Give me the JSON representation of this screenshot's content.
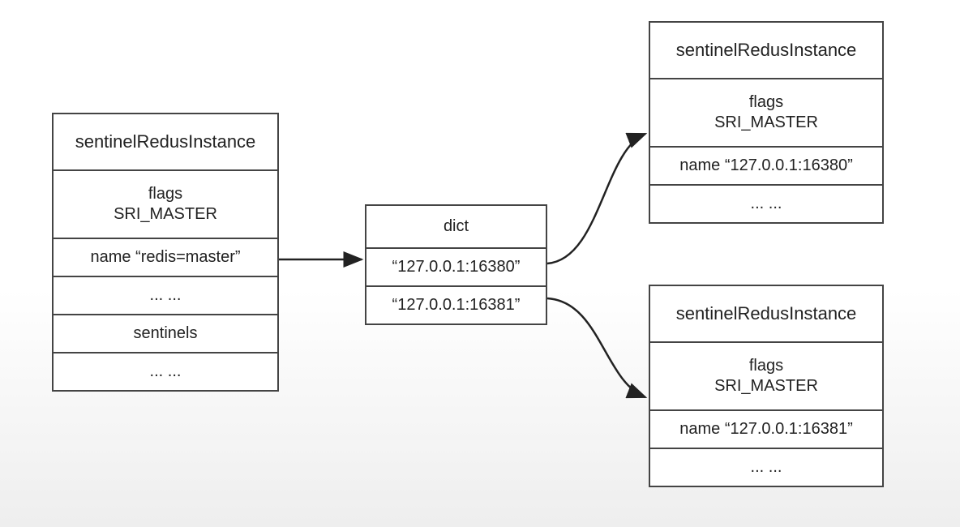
{
  "left": {
    "title": "sentinelRedusInstance",
    "flags_label": "flags",
    "flags_value": "SRI_MASTER",
    "name": "name “redis=master”",
    "ellipsis1": "... ...",
    "sentinels_label": "sentinels",
    "ellipsis2": "... ..."
  },
  "dict": {
    "title": "dict",
    "items": [
      "“127.0.0.1:16380”",
      "“127.0.0.1:16381”"
    ]
  },
  "right_top": {
    "title": "sentinelRedusInstance",
    "flags_label": "flags",
    "flags_value": "SRI_MASTER",
    "name": "name “127.0.0.1:16380”",
    "ellipsis": "... ..."
  },
  "right_bottom": {
    "title": "sentinelRedusInstance",
    "flags_label": "flags",
    "flags_value": "SRI_MASTER",
    "name": "name “127.0.0.1:16381”",
    "ellipsis": "... ..."
  }
}
